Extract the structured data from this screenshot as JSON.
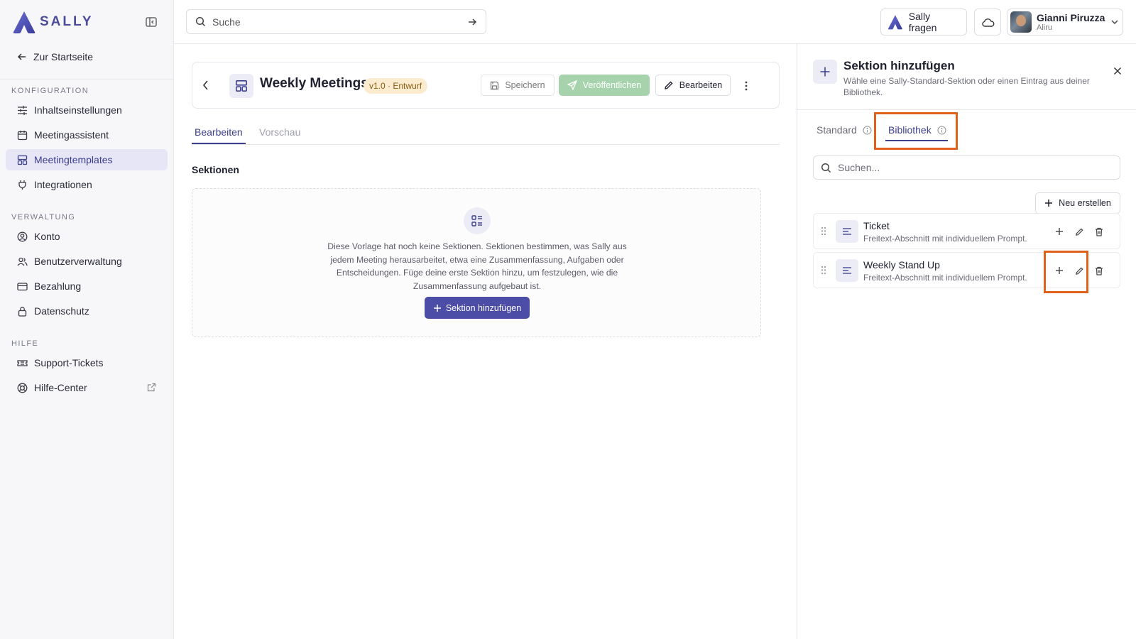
{
  "brand": {
    "name": "SALLY",
    "accent": "#3c3e8e",
    "primary_button": "#4b4da6",
    "highlight": "#e0621a"
  },
  "sidebar": {
    "home_link": "Zur Startseite",
    "sections": [
      {
        "title": "KONFIGURATION",
        "items": [
          {
            "label": "Inhaltseinstellungen",
            "icon": "sliders-icon"
          },
          {
            "label": "Meetingassistent",
            "icon": "calendar-icon"
          },
          {
            "label": "Meetingtemplates",
            "icon": "layout-template-icon",
            "active": true
          },
          {
            "label": "Integrationen",
            "icon": "plug-icon"
          }
        ]
      },
      {
        "title": "VERWALTUNG",
        "items": [
          {
            "label": "Konto",
            "icon": "user-circle-icon"
          },
          {
            "label": "Benutzerverwaltung",
            "icon": "users-icon"
          },
          {
            "label": "Bezahlung",
            "icon": "credit-card-icon"
          },
          {
            "label": "Datenschutz",
            "icon": "lock-icon"
          }
        ]
      },
      {
        "title": "HILFE",
        "items": [
          {
            "label": "Support-Tickets",
            "icon": "ticket-icon"
          },
          {
            "label": "Hilfe-Center",
            "icon": "lifebuoy-icon"
          }
        ]
      }
    ]
  },
  "topbar": {
    "search_placeholder": "Suche",
    "ask_sally": "Sally fragen",
    "user": {
      "name": "Gianni Piruzza",
      "org": "Aliru"
    }
  },
  "template": {
    "title": "Weekly Meetings",
    "badge": "v1.0 · Entwurf",
    "save_label": "Speichern",
    "publish_label": "Veröffentlichen",
    "edit_label": "Bearbeiten",
    "tabs": [
      "Bearbeiten",
      "Vorschau"
    ],
    "sections_heading": "Sektionen",
    "empty_text": "Diese Vorlage hat noch keine Sektionen. Sektionen bestimmen, was Sally aus jedem Meeting herausarbeitet, etwa eine Zusammenfassung, Aufgaben oder Entscheidungen. Füge deine erste Sektion hinzu, um festzulegen, wie die Zusammenfassung aufgebaut ist.",
    "add_section_label": "Sektion hinzufügen"
  },
  "panel": {
    "title": "Sektion hinzufügen",
    "subtitle": "Wähle eine Sally-Standard-Sektion oder einen Eintrag aus deiner Bibliothek.",
    "tabs": [
      "Standard",
      "Bibliothek"
    ],
    "active_tab": "Bibliothek",
    "search_placeholder": "Suchen...",
    "new_label": "Neu erstellen",
    "items": [
      {
        "title": "Ticket",
        "desc": "Freitext-Abschnitt mit individuellem Prompt."
      },
      {
        "title": "Weekly Stand Up",
        "desc": "Freitext-Abschnitt mit individuellem Prompt."
      }
    ]
  }
}
